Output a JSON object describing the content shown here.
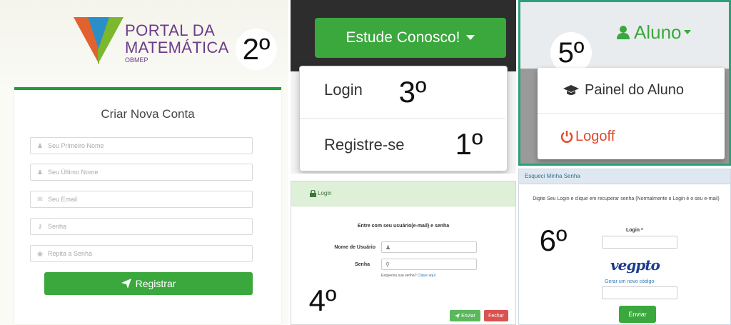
{
  "panel1": {
    "logo": {
      "line1": "PORTAL DA",
      "line2": "MATEMÁTICA",
      "line3": "OBMEP"
    },
    "step": "2º",
    "form_title": "Criar Nova Conta",
    "fields": [
      {
        "icon": "user-icon",
        "placeholder": "Seu Primeiro Nome"
      },
      {
        "icon": "user-icon",
        "placeholder": "Seu Último Nome"
      },
      {
        "icon": "envelope-icon",
        "placeholder": "Seu Email"
      },
      {
        "icon": "key-icon",
        "placeholder": "Senha"
      },
      {
        "icon": "eye-icon",
        "placeholder": "Repita a Senha"
      }
    ],
    "submit_label": "Registrar"
  },
  "panel2": {
    "button_label": "Estude Conosco!",
    "menu": [
      {
        "label": "Login",
        "step": "3º"
      },
      {
        "label": "Registre-se",
        "step": "1º"
      }
    ]
  },
  "panel3": {
    "step": "5º",
    "user_label": "Aluno",
    "menu": [
      {
        "icon": "graduation-cap-icon",
        "label": "Painel do Aluno"
      },
      {
        "icon": "power-icon",
        "label": "Logoff"
      }
    ]
  },
  "panel4": {
    "header": "Login",
    "instruction": "Entre com seu usuário(e-mail) e senha",
    "user_label": "Nome de Usuário",
    "pass_label": "Senha",
    "forgot_text": "Esqueceu sua senha?",
    "forgot_link": "Clique aqui",
    "step": "4º",
    "send_label": "Enviar",
    "close_label": "Fechar"
  },
  "panel5": {
    "header": "Esqueci Minha Senha",
    "instruction": "Digite Seu Login e clique em recuperar senha (Normalmente o Login é o seu e-mail)",
    "login_label": "Login *",
    "step": "6º",
    "captcha_text": "vegpto",
    "new_code_link": "Gerar um novo código",
    "send_label": "Enviar"
  },
  "colors": {
    "green": "#3ba83e",
    "dark_green": "#1f9d3a",
    "red": "#d9534f",
    "teal": "#2aa178",
    "logoff_red": "#e24a2c"
  }
}
